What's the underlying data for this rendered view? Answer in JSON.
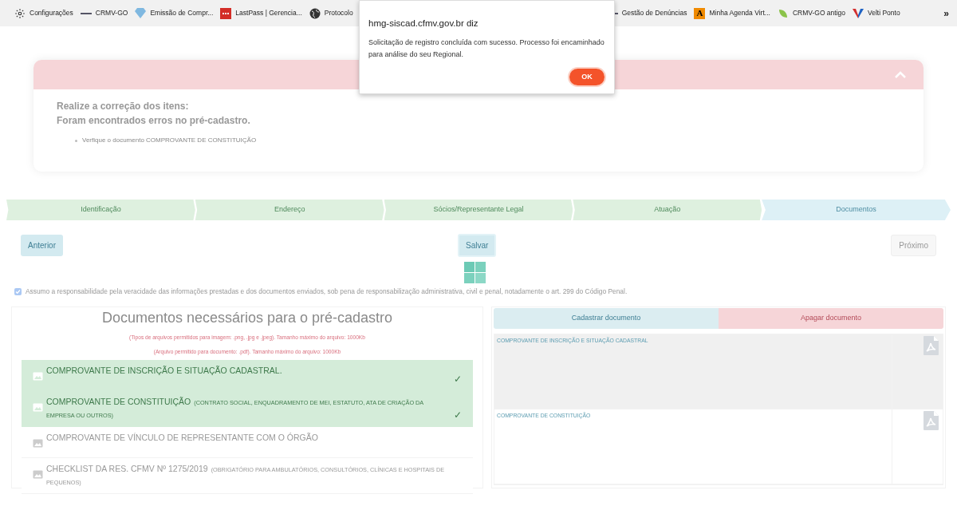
{
  "bookmarks": [
    {
      "kind": "gear",
      "label": "Configurações"
    },
    {
      "kind": "dash",
      "label": "CRMV-GO"
    },
    {
      "kind": "gem",
      "label": "Emissão de Compr..."
    },
    {
      "kind": "dots",
      "label": "LastPass | Gerencia..."
    },
    {
      "kind": "globe",
      "label": "Protocolo"
    },
    {
      "kind": "dash",
      "label": "Gestão de Denúncias"
    },
    {
      "kind": "letter",
      "label": "Minha Agenda Virt...",
      "glyph": "A"
    },
    {
      "kind": "leaf",
      "label": "CRMV-GO antigo"
    },
    {
      "kind": "v",
      "label": "Velti Ponto"
    }
  ],
  "bookmarks_overflow": "»",
  "dialog": {
    "title": "hmg-siscad.cfmv.gov.br diz",
    "message": "Solicitação de registro concluída com sucesso. Processo foi encaminhado para análise do seu Regional.",
    "ok": "OK"
  },
  "alert": {
    "expanded": true,
    "headings": [
      "Realize a correção dos itens:",
      "Foram encontrados erros no pré-cadastro."
    ],
    "items": [
      "Verfique o documento COMPROVANTE DE CONSTITUIÇÃO"
    ]
  },
  "steps": [
    {
      "label": "Identificação",
      "selected": false
    },
    {
      "label": "Endereço",
      "selected": false
    },
    {
      "label": "Sócios/Representante Legal",
      "selected": false
    },
    {
      "label": "Atuação",
      "selected": false
    },
    {
      "label": "Documentos",
      "selected": true
    }
  ],
  "nav": {
    "previous": "Anterior",
    "save": "Salvar",
    "next": {
      "label": "Próximo",
      "disabled": true
    }
  },
  "consent": {
    "checked": true,
    "text": "Assumo a responsabilidade pela veracidade das informações prestadas e dos documentos enviados, sob pena de responsabilização administrativa, civil e penal, notadamente o art. 299 do Código Penal."
  },
  "documents": {
    "title": "Documentos necessários para o pré-cadastro",
    "notes": [
      "(Tipos de arquivos permitidos para imagem: .png, .jpg e .jpeg). Tamanho máximo do arquivo: 1000Kb",
      "(Arquivo permitido para documento: .pdf). Tamanho máximo do arquivo: 1000Kb"
    ],
    "items": [
      {
        "name": "COMPROVANTE DE INSCRIÇÃO E SITUAÇÃO CADASTRAL.",
        "done": true
      },
      {
        "name": "COMPROVANTE DE CONSTITUIÇÃO",
        "detail": "(CONTRATO SOCIAL, ENQUADRAMENTO DE MEI, ESTATUTO, ATA DE CRIAÇÃO DA EMPRESA OU OUTROS)",
        "done": true
      },
      {
        "name": "COMPROVANTE DE VÍNCULO DE REPRESENTANTE COM O ÓRGÃO",
        "done": false
      },
      {
        "name": "CHECKLIST DA RES. CFMV Nº 1275/2019",
        "detail": "(OBRIGATÓRIO PARA AMBULATÓRIOS, CONSULTÓRIOS, CLÍNICAS E HOSPITAIS DE PEQUENOS)",
        "done": false
      }
    ],
    "check_mark": "✓"
  },
  "uploads": {
    "register": "Cadastrar documento",
    "delete": "Apagar documento",
    "files": [
      {
        "label": "COMPROVANTE DE INSCRIÇÃO E SITUAÇÃO CADASTRAL",
        "selected": true
      },
      {
        "label": "COMPROVANTE DE CONSTITUIÇÃO",
        "selected": false
      }
    ]
  }
}
